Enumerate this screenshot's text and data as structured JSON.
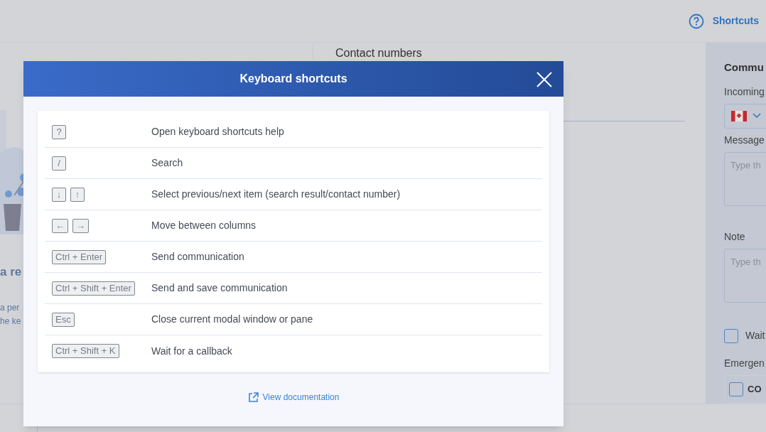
{
  "header": {
    "help_label": "Shortcuts"
  },
  "left_panel": {
    "heading": "a re",
    "lines": [
      "a per",
      "he ke"
    ]
  },
  "middle_panel": {
    "heading": "Contact numbers"
  },
  "right_panel": {
    "heading": "Commu",
    "incoming_label": "Incoming",
    "message_label": "Message",
    "message_placeholder": "Type th",
    "note_label": "Note",
    "note_placeholder": "Type th",
    "wait": {
      "label": "Wait",
      "checked": false
    },
    "emergency_label": "Emergen",
    "emergency_option": {
      "label": "CO",
      "checked": false
    }
  },
  "modal": {
    "title": "Keyboard shortcuts",
    "shortcuts": [
      {
        "keys": [
          "?"
        ],
        "description": "Open keyboard shortcuts help"
      },
      {
        "keys": [
          "/"
        ],
        "description": "Search"
      },
      {
        "keys": [
          "↓",
          "↑"
        ],
        "description": "Select previous/next item (search result/contact number)"
      },
      {
        "keys": [
          "←",
          "→"
        ],
        "description": "Move between columns"
      },
      {
        "keys": [
          "Ctrl + Enter"
        ],
        "description": "Send communication"
      },
      {
        "keys": [
          "Ctrl + Shift + Enter"
        ],
        "description": "Send and save communication"
      },
      {
        "keys": [
          "Esc"
        ],
        "description": "Close current modal window or pane"
      },
      {
        "keys": [
          "Ctrl + Shift + K"
        ],
        "description": "Wait for a callback"
      }
    ],
    "link": "View documentation"
  }
}
